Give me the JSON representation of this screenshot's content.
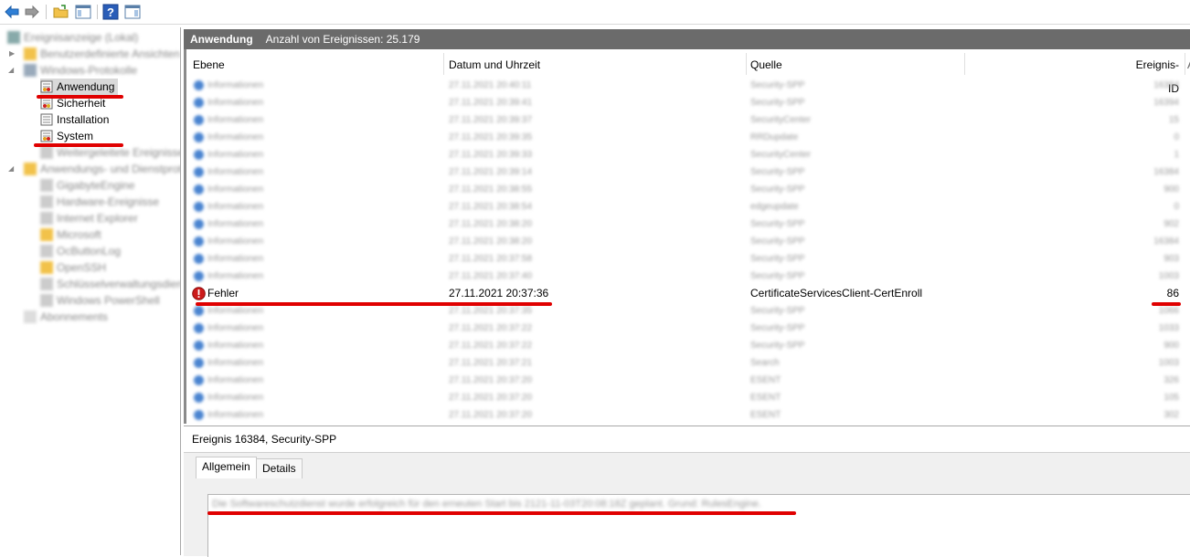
{
  "toolbar": {
    "buttons": [
      "back-icon",
      "forward-icon",
      "open-folder-icon",
      "show-hide-tree-icon",
      "help-icon",
      "show-hide-action-icon"
    ]
  },
  "tree": {
    "root": "Ereignisanzeige (Lokal)",
    "custom_views": "Benutzerdefinierte Ansichten",
    "windows_logs": "Windows-Protokolle",
    "logs": [
      {
        "label": "Anwendung",
        "selected": true
      },
      {
        "label": "Sicherheit"
      },
      {
        "label": "Installation"
      },
      {
        "label": "System"
      },
      {
        "label": "Weitergeleitete Ereignisse"
      }
    ],
    "apps_services": "Anwendungs- und Dienstprotokolle",
    "app_logs": [
      "GigabyteEngine",
      "Hardware-Ereignisse",
      "Internet Explorer",
      "Microsoft",
      "OcButtonLog",
      "OpenSSH",
      "Schlüsselverwaltungsdienst",
      "Windows PowerShell"
    ],
    "subscriptions": "Abonnements"
  },
  "main": {
    "title": "Anwendung",
    "count_label": "Anzahl von Ereignissen: 25.179"
  },
  "list": {
    "columns": {
      "level": "Ebene",
      "datetime": "Datum und Uhrzeit",
      "source": "Quelle",
      "event_id": "Ereignis-ID",
      "extra": "A"
    },
    "highlight_row": {
      "level": "Fehler",
      "datetime": "27.11.2021 20:37:36",
      "source": "CertificateServicesClient-CertEnroll",
      "event_id": "86"
    },
    "blurred_rows_before": [
      {
        "level": "Informationen",
        "datetime": "27.11.2021 20:40:11",
        "source": "Security-SPP",
        "id": "16384"
      },
      {
        "level": "Informationen",
        "datetime": "27.11.2021 20:39:41",
        "source": "Security-SPP",
        "id": "16394"
      },
      {
        "level": "Informationen",
        "datetime": "27.11.2021 20:39:37",
        "source": "SecurityCenter",
        "id": "15"
      },
      {
        "level": "Informationen",
        "datetime": "27.11.2021 20:39:35",
        "source": "RRDupdate",
        "id": "0"
      },
      {
        "level": "Informationen",
        "datetime": "27.11.2021 20:39:33",
        "source": "SecurityCenter",
        "id": "1"
      },
      {
        "level": "Informationen",
        "datetime": "27.11.2021 20:39:14",
        "source": "Security-SPP",
        "id": "16384"
      },
      {
        "level": "Informationen",
        "datetime": "27.11.2021 20:38:55",
        "source": "Security-SPP",
        "id": "900"
      },
      {
        "level": "Informationen",
        "datetime": "27.11.2021 20:38:54",
        "source": "edgeupdate",
        "id": "0"
      },
      {
        "level": "Informationen",
        "datetime": "27.11.2021 20:38:20",
        "source": "Security-SPP",
        "id": "902"
      },
      {
        "level": "Informationen",
        "datetime": "27.11.2021 20:38:20",
        "source": "Security-SPP",
        "id": "16384"
      },
      {
        "level": "Informationen",
        "datetime": "27.11.2021 20:37:58",
        "source": "Security-SPP",
        "id": "903"
      },
      {
        "level": "Informationen",
        "datetime": "27.11.2021 20:37:40",
        "source": "Security-SPP",
        "id": "1003"
      }
    ],
    "blurred_rows_after": [
      {
        "level": "Informationen",
        "datetime": "27.11.2021 20:37:35",
        "source": "Security-SPP",
        "id": "1066"
      },
      {
        "level": "Informationen",
        "datetime": "27.11.2021 20:37:22",
        "source": "Security-SPP",
        "id": "1033"
      },
      {
        "level": "Informationen",
        "datetime": "27.11.2021 20:37:22",
        "source": "Security-SPP",
        "id": "900"
      },
      {
        "level": "Informationen",
        "datetime": "27.11.2021 20:37:21",
        "source": "Search",
        "id": "1003"
      },
      {
        "level": "Informationen",
        "datetime": "27.11.2021 20:37:20",
        "source": "ESENT",
        "id": "326"
      },
      {
        "level": "Informationen",
        "datetime": "27.11.2021 20:37:20",
        "source": "ESENT",
        "id": "105"
      },
      {
        "level": "Informationen",
        "datetime": "27.11.2021 20:37:20",
        "source": "ESENT",
        "id": "302"
      }
    ]
  },
  "detail": {
    "title": "Ereignis 16384, Security-SPP",
    "tabs": [
      "Allgemein",
      "Details"
    ],
    "text": "Die Softwareschutzdienst wurde erfolgreich für den erneuten Start bis 2121-11-03T20:08:18Z geplant. Grund: RulesEngine."
  },
  "colors": {
    "annotation_red": "#e00000",
    "header_gray": "#6b6b6b",
    "selected_gray": "#d9d9d9"
  }
}
